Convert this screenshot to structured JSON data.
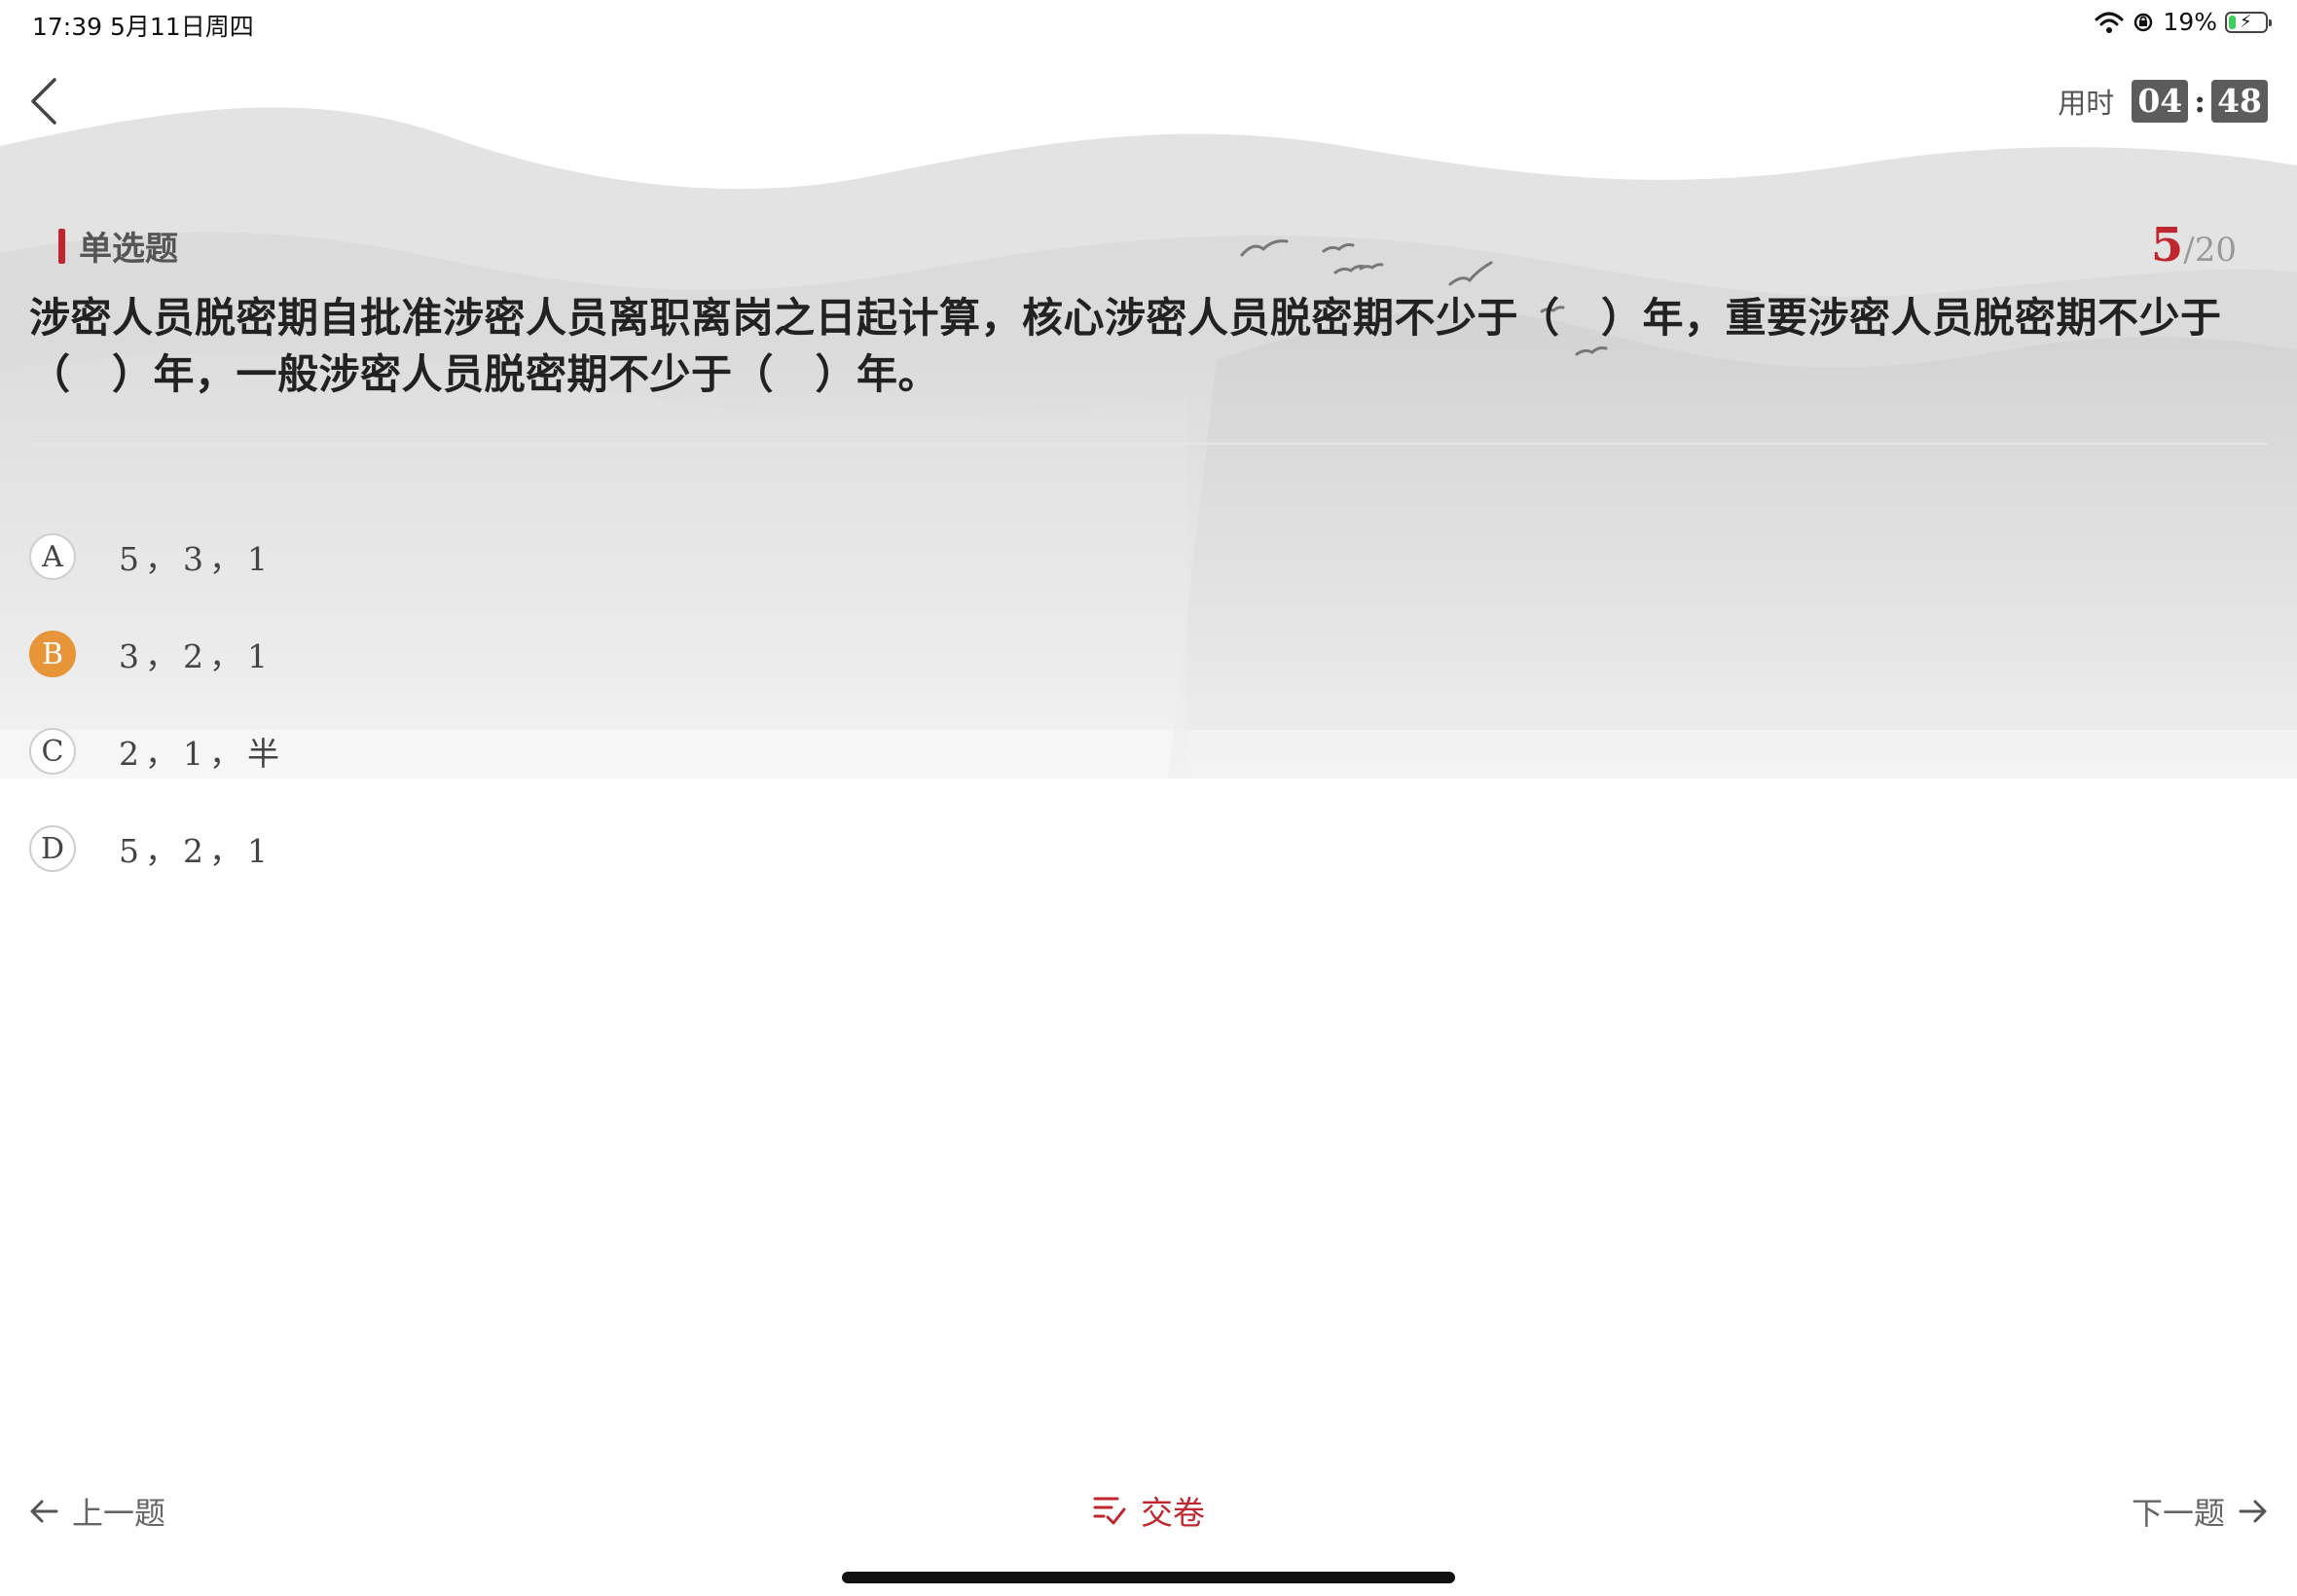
{
  "status_bar": {
    "time_date": "17:39   5月11日周四",
    "battery": "19%",
    "battery_level": 0.19
  },
  "header": {
    "timer_label": "用时",
    "timer_minutes": "04",
    "timer_seconds": "48"
  },
  "question": {
    "type": "单选题",
    "current": "5",
    "total": "/20",
    "text": "涉密人员脱密期自批准涉密人员离职离岗之日起计算，核心涉密人员脱密期不少于（　）年，重要涉密人员脱密期不少于（　）年，一般涉密人员脱密期不少于（　）年。"
  },
  "options": [
    {
      "letter": "A",
      "text": "5，3，1",
      "selected": false
    },
    {
      "letter": "B",
      "text": "3，2，1",
      "selected": true
    },
    {
      "letter": "C",
      "text": "2，1，半",
      "selected": false
    },
    {
      "letter": "D",
      "text": "5，2，1",
      "selected": false
    }
  ],
  "footer": {
    "prev_label": "上一题",
    "submit_label": "交卷",
    "next_label": "下一题"
  },
  "colors": {
    "accent_red": "#c0262d",
    "selected_orange": "#e8953a",
    "timer_box": "#5c5c5c"
  }
}
